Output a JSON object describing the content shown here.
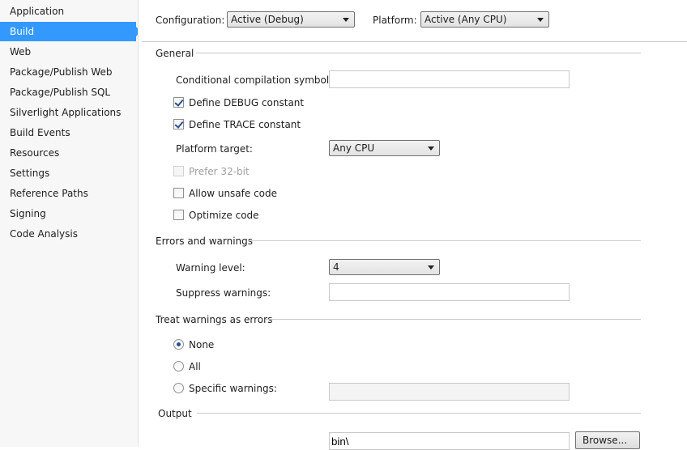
{
  "sidebar": {
    "items": [
      {
        "label": "Application"
      },
      {
        "label": "Build"
      },
      {
        "label": "Web"
      },
      {
        "label": "Package/Publish Web"
      },
      {
        "label": "Package/Publish SQL"
      },
      {
        "label": "Silverlight Applications"
      },
      {
        "label": "Build Events"
      },
      {
        "label": "Resources"
      },
      {
        "label": "Settings"
      },
      {
        "label": "Reference Paths"
      },
      {
        "label": "Signing"
      },
      {
        "label": "Code Analysis"
      }
    ],
    "selected": "Build"
  },
  "header": {
    "configuration_label": "Configuration:",
    "configuration_value": "Active (Debug)",
    "platform_label": "Platform:",
    "platform_value": "Active (Any CPU)"
  },
  "general": {
    "title": "General",
    "conditional_symbols_label": "Conditional compilation symbols:",
    "conditional_symbols_value": "",
    "define_debug": {
      "label": "Define DEBUG constant",
      "checked": true
    },
    "define_trace": {
      "label": "Define TRACE constant",
      "checked": true
    },
    "platform_target_label": "Platform target:",
    "platform_target_value": "Any CPU",
    "prefer32": {
      "label": "Prefer 32-bit",
      "checked": false,
      "enabled": false
    },
    "allow_unsafe": {
      "label": "Allow unsafe code",
      "checked": false
    },
    "optimize": {
      "label": "Optimize code",
      "checked": false
    }
  },
  "errors": {
    "title": "Errors and warnings",
    "warning_level_label": "Warning level:",
    "warning_level_value": "4",
    "suppress_label": "Suppress warnings:",
    "suppress_value": ""
  },
  "treat": {
    "title": "Treat warnings as errors",
    "options": [
      {
        "label": "None",
        "checked": true
      },
      {
        "label": "All",
        "checked": false
      },
      {
        "label": "Specific warnings:",
        "checked": false
      }
    ],
    "specific_value": ""
  },
  "output": {
    "title": "Output",
    "output_path_value": "bin\\",
    "browse_label": "Browse..."
  },
  "colors": {
    "accent": "#3399ff",
    "sidebar_bg": "#f7f7f7"
  }
}
